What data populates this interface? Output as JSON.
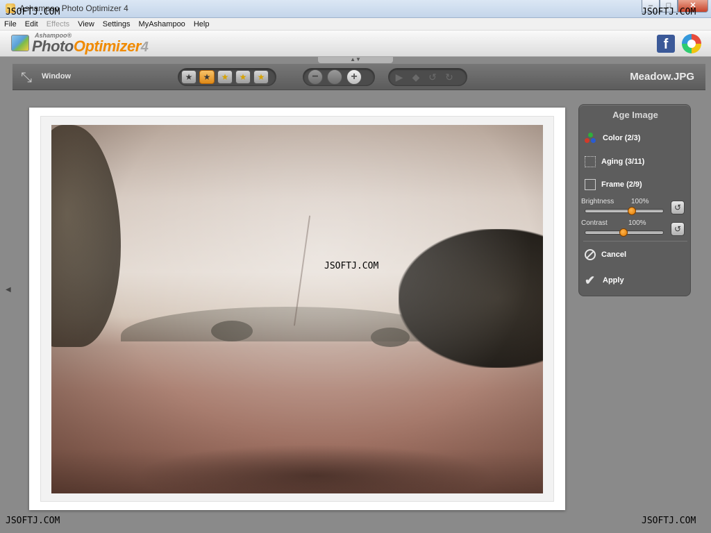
{
  "window": {
    "title": "Ashampoo Photo Optimizer 4",
    "buttons": {
      "minimize": "–",
      "maximize": "□",
      "close": "✕"
    }
  },
  "menu": {
    "items": [
      "File",
      "Edit",
      "Effects",
      "View",
      "Settings",
      "MyAshampoo",
      "Help"
    ]
  },
  "logo": {
    "small": "Ashampoo®",
    "part1": "Photo",
    "part2": "Optimizer",
    "part3": "4"
  },
  "social": {
    "facebook_glyph": "f"
  },
  "toolbar": {
    "window_label": "Window",
    "filename": "Meadow.JPG",
    "rating_icons": [
      "star-1",
      "star-2",
      "star-3",
      "star-4",
      "star-5"
    ],
    "zoom": {
      "out": "−",
      "fit": "",
      "in": "+"
    }
  },
  "panel": {
    "title": "Age Image",
    "color_label": "Color (2/3)",
    "aging_label": "Aging (3/11)",
    "frame_label": "Frame (2/9)",
    "brightness": {
      "label": "Brightness",
      "value": "100%",
      "level": 0.6
    },
    "contrast": {
      "label": "Contrast",
      "value": "100%",
      "level": 0.48
    },
    "cancel_label": "Cancel",
    "apply_label": "Apply"
  },
  "watermarks": {
    "top_left": "JSOFTJ.COM",
    "top_right": "JSOFTJ.COM",
    "center": "JSOFTJ.COM",
    "bottom_left": "JSOFTJ.COM",
    "bottom_right": "JSOFTJ.COM"
  },
  "colors": {
    "accent": "#f08a00",
    "panel_bg": "#5d5d5d",
    "toolbar_bg": "#666666"
  }
}
